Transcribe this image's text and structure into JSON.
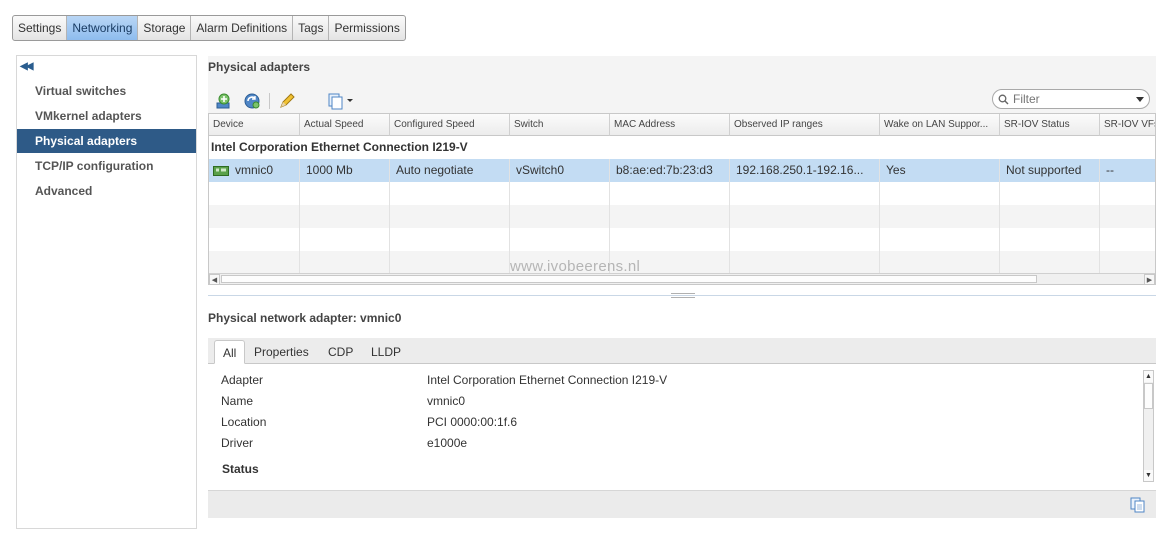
{
  "top_tabs": [
    {
      "label": "Settings"
    },
    {
      "label": "Networking",
      "active": true
    },
    {
      "label": "Storage"
    },
    {
      "label": "Alarm Definitions"
    },
    {
      "label": "Tags"
    },
    {
      "label": "Permissions"
    }
  ],
  "sidebar": {
    "collapse_icon": "double-chevron-left",
    "items": [
      {
        "label": "Virtual switches"
      },
      {
        "label": "VMkernel adapters"
      },
      {
        "label": "Physical adapters",
        "active": true
      },
      {
        "label": "TCP/IP configuration"
      },
      {
        "label": "Advanced"
      }
    ]
  },
  "main": {
    "title": "Physical adapters",
    "toolbar_icons": [
      "add-host-networking-icon",
      "refresh-icon",
      "edit-pencil-icon",
      "actions-menu-icon"
    ],
    "filter_placeholder": "Filter",
    "columns": [
      "Device",
      "Actual Speed",
      "Configured Speed",
      "Switch",
      "MAC Address",
      "Observed IP ranges",
      "Wake on LAN Suppor...",
      "SR-IOV Status",
      "SR-IOV VFs"
    ],
    "group_label": "Intel Corporation Ethernet Connection I219-V",
    "rows": [
      {
        "device": "vmnic0",
        "actual_speed": "1000 Mb",
        "configured_speed": "Auto negotiate",
        "switch": "vSwitch0",
        "mac": "b8:ae:ed:7b:23:d3",
        "ip_ranges": "192.168.250.1-192.16...",
        "wol": "Yes",
        "sriov_status": "Not supported",
        "sriov_vfs": "--"
      }
    ],
    "watermark": "www.ivobeerens.nl"
  },
  "detail": {
    "title": "Physical network adapter: vmnic0",
    "tabs": [
      {
        "label": "All",
        "active": true
      },
      {
        "label": "Properties"
      },
      {
        "label": "CDP"
      },
      {
        "label": "LLDP"
      }
    ],
    "properties": [
      {
        "label": "Adapter",
        "value": "Intel Corporation Ethernet Connection I219-V"
      },
      {
        "label": "Name",
        "value": "vmnic0"
      },
      {
        "label": "Location",
        "value": "PCI 0000:00:1f.6"
      },
      {
        "label": "Driver",
        "value": "e1000e"
      }
    ],
    "section_label": "Status"
  },
  "colors": {
    "accent": "#2e5a87",
    "selection": "#c3dcf3",
    "active_tab": "#8ebcee"
  }
}
